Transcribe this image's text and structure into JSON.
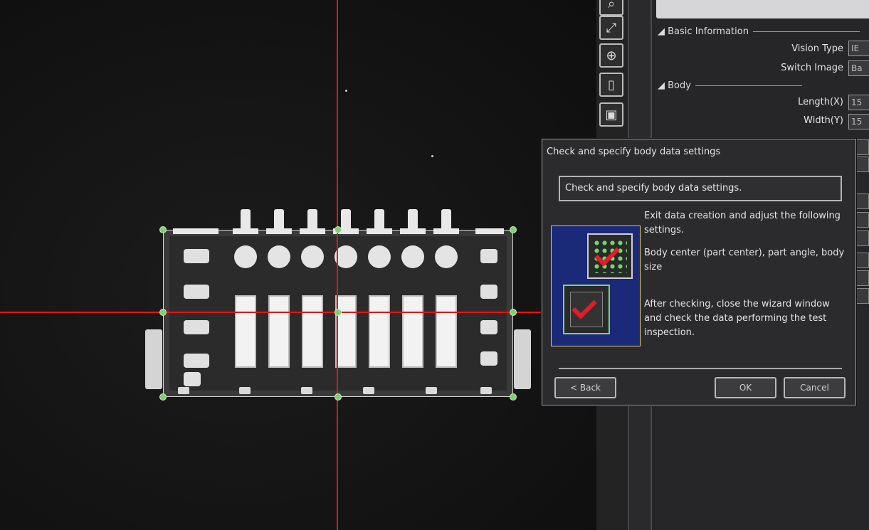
{
  "toolbar": {
    "tools": [
      {
        "icon": "search-icon",
        "glyph": "⌕"
      },
      {
        "icon": "diagonal-arrow-icon",
        "glyph": "⤢"
      },
      {
        "icon": "zoom-icon",
        "glyph": "⊕"
      },
      {
        "icon": "fit-height-icon",
        "glyph": "▯"
      },
      {
        "icon": "camera-settings-icon",
        "glyph": "▣"
      }
    ]
  },
  "property_panel": {
    "breadcrumb": "",
    "sections": [
      {
        "title": "Basic Information",
        "rows": [
          {
            "label": "Vision Type",
            "value": "IE"
          },
          {
            "label": "Switch Image",
            "value": "Ba"
          }
        ]
      },
      {
        "title": "Body",
        "rows": [
          {
            "label": "Length(X)",
            "value": "15"
          },
          {
            "label": "Width(Y)",
            "value": "15"
          }
        ]
      }
    ]
  },
  "dialog": {
    "title": "Check and specify body data settings",
    "heading": "Check and specify body data settings.",
    "paragraphs": [
      "Exit data creation and adjust the following settings.",
      "Body center (part center), part angle, body size",
      "After checking, close the wizard window and check the data performing the test inspection."
    ],
    "buttons": {
      "back": "< Back",
      "ok": "OK",
      "cancel": "Cancel"
    }
  },
  "colors": {
    "crosshair": "#e0161a",
    "handle": "#7cd26b",
    "image_bg": "#1a2a78",
    "check": "#e11d2a"
  }
}
